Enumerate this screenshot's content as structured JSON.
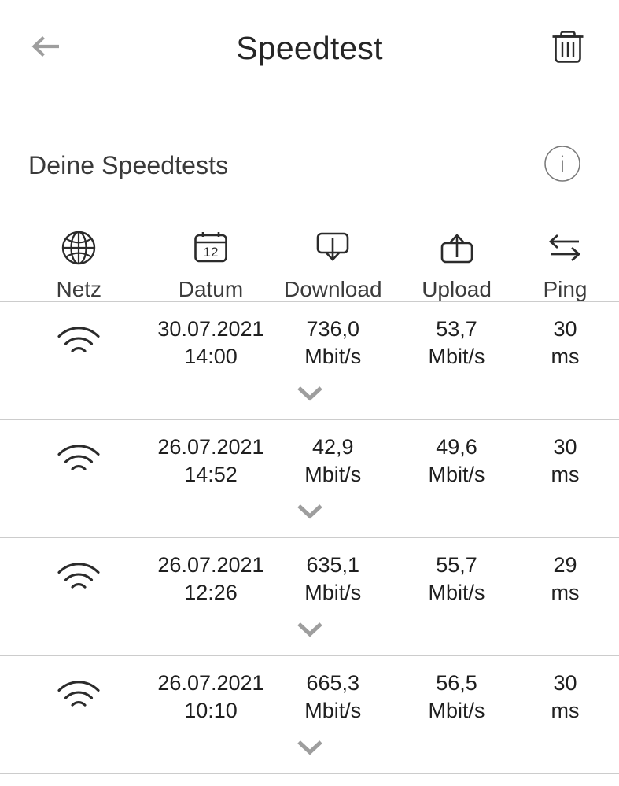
{
  "header": {
    "title": "Speedtest",
    "back_icon": "arrow-left-icon",
    "delete_icon": "trash-icon"
  },
  "section": {
    "title": "Deine Speedtests",
    "info_icon": "info-circle-icon"
  },
  "columns": [
    {
      "label": "Netz",
      "icon": "globe-icon"
    },
    {
      "label": "Datum",
      "icon": "calendar-icon"
    },
    {
      "label": "Download",
      "icon": "download-box-icon"
    },
    {
      "label": "Upload",
      "icon": "upload-box-icon"
    },
    {
      "label": "Ping",
      "icon": "swap-arrows-icon"
    }
  ],
  "calendar_day": "12",
  "rows": [
    {
      "network_icon": "wifi-icon",
      "date": "30.07.2021",
      "time": "14:00",
      "download_value": "736,0",
      "download_unit": "Mbit/s",
      "upload_value": "53,7",
      "upload_unit": "Mbit/s",
      "ping_value": "30",
      "ping_unit": "ms",
      "expand_icon": "chevron-down-icon"
    },
    {
      "network_icon": "wifi-icon",
      "date": "26.07.2021",
      "time": "14:52",
      "download_value": "42,9",
      "download_unit": "Mbit/s",
      "upload_value": "49,6",
      "upload_unit": "Mbit/s",
      "ping_value": "30",
      "ping_unit": "ms",
      "expand_icon": "chevron-down-icon"
    },
    {
      "network_icon": "wifi-icon",
      "date": "26.07.2021",
      "time": "12:26",
      "download_value": "635,1",
      "download_unit": "Mbit/s",
      "upload_value": "55,7",
      "upload_unit": "Mbit/s",
      "ping_value": "29",
      "ping_unit": "ms",
      "expand_icon": "chevron-down-icon"
    },
    {
      "network_icon": "wifi-icon",
      "date": "26.07.2021",
      "time": "10:10",
      "download_value": "665,3",
      "download_unit": "Mbit/s",
      "upload_value": "56,5",
      "upload_unit": "Mbit/s",
      "ping_value": "30",
      "ping_unit": "ms",
      "expand_icon": "chevron-down-icon"
    }
  ],
  "colors": {
    "background": "#ffffff",
    "text": "#1f1f1f",
    "title": "#262626",
    "divider": "#cccccc",
    "muted_icon": "#9e9e9e",
    "dark_icon": "#2b2b2b"
  }
}
